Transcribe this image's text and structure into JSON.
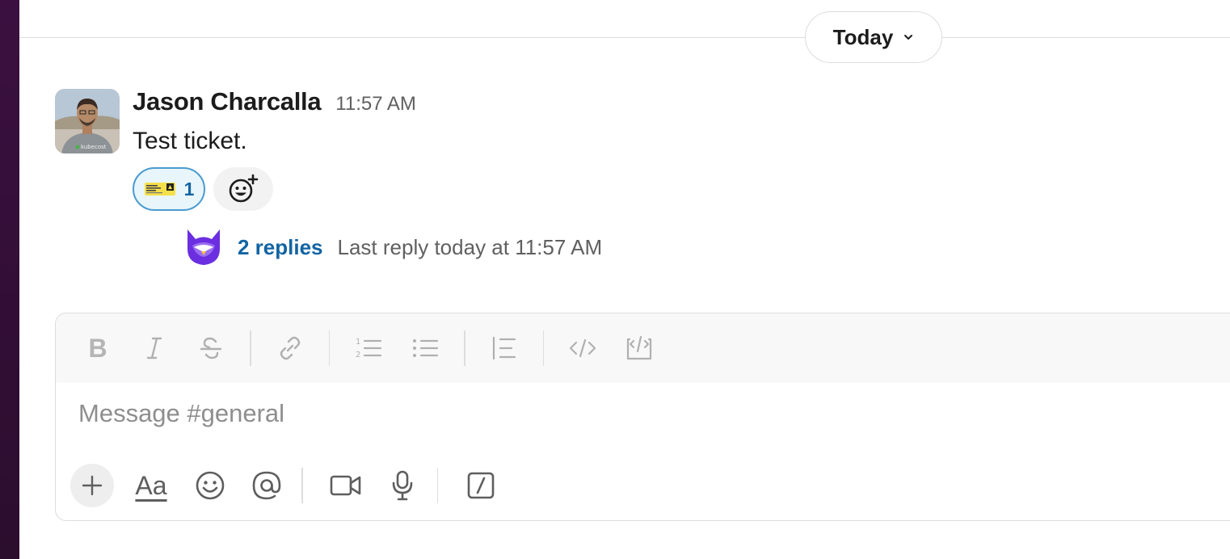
{
  "divider": {
    "date_label": "Today"
  },
  "message": {
    "author": "Jason Charcalla",
    "time": "11:57 AM",
    "text": "Test ticket.",
    "avatar_shirt_text": "kubecost",
    "reactions": [
      {
        "emoji": "live-concert-ticket",
        "count": "1"
      }
    ],
    "thread": {
      "replies": "2 replies",
      "last_reply": "Last reply today at 11:57 AM"
    }
  },
  "composer": {
    "placeholder": "Message #general",
    "format_toolbar": [
      "bold-icon",
      "italic-icon",
      "strikethrough-icon",
      "link-icon",
      "ordered-list-icon",
      "bulleted-list-icon",
      "blockquote-icon",
      "code-icon",
      "code-block-icon"
    ],
    "bottom_toolbar": [
      "plus-icon",
      "formatting-icon",
      "emoji-icon",
      "mention-icon",
      "video-icon",
      "microphone-icon",
      "shortcuts-icon"
    ],
    "formatting_label": "Aa",
    "bold_label": "B"
  },
  "colors": {
    "link": "#1264a3",
    "reaction_border": "#4a9bd1",
    "sidebar": "#3f0e40",
    "owl": "#6b2ee0"
  }
}
